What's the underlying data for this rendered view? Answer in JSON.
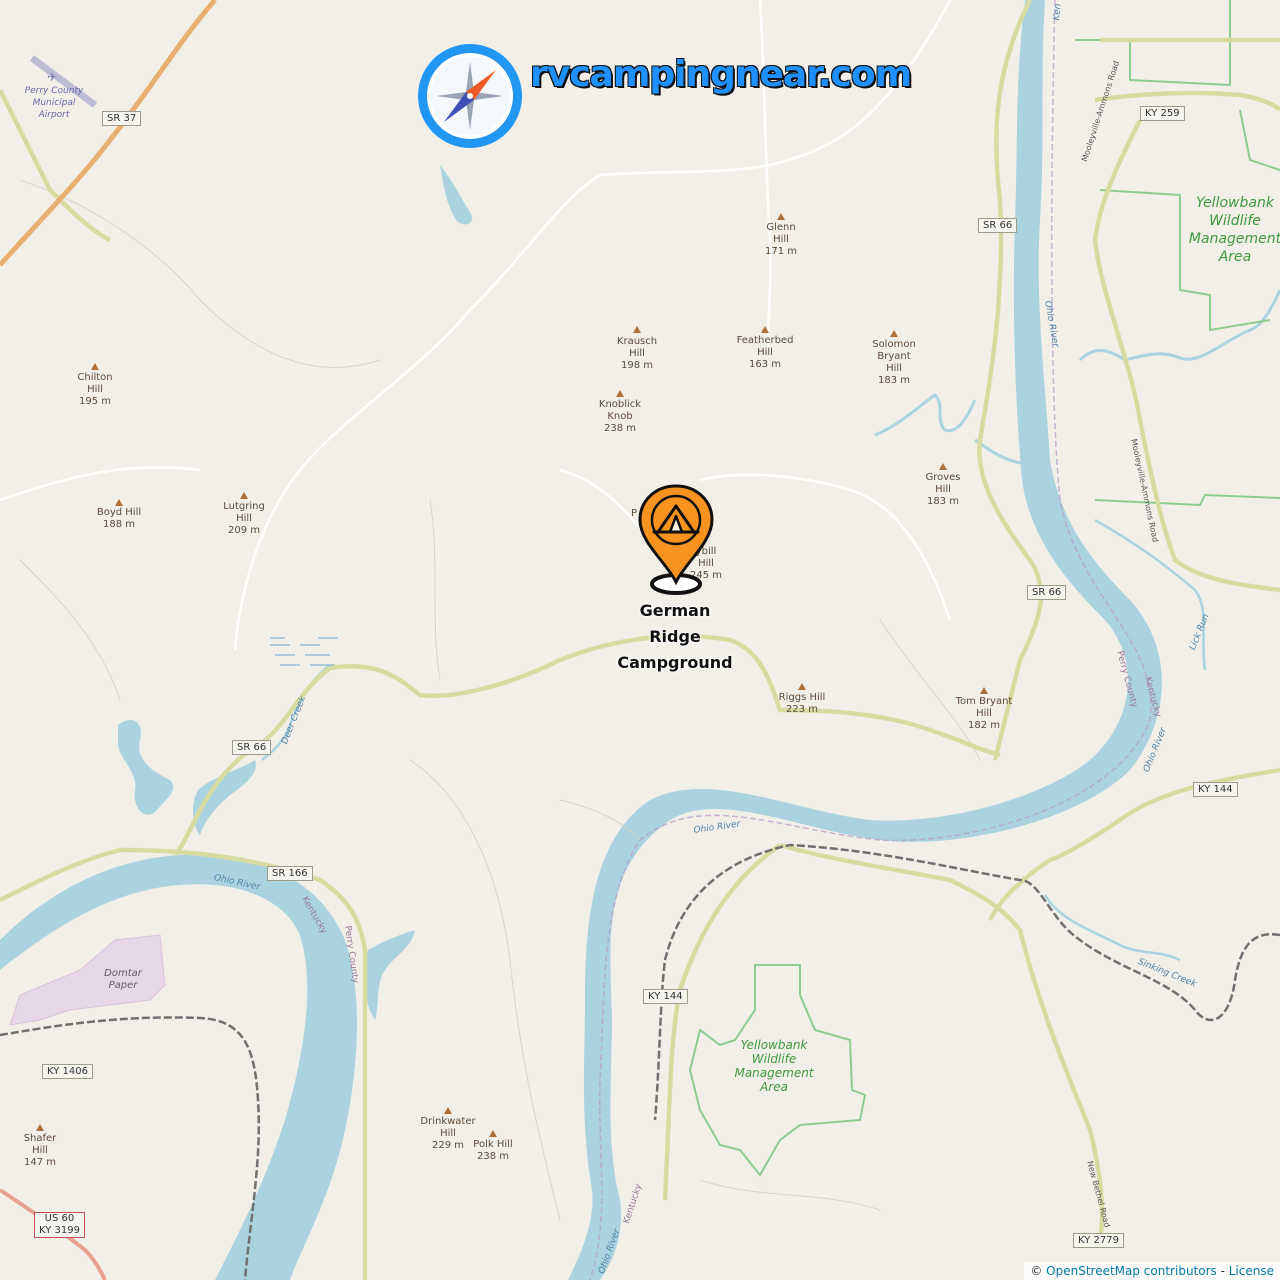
{
  "brand": {
    "text": "rvcampingnear.com",
    "icon": "compass-icon"
  },
  "campground": {
    "name": "German\nRidge\nCampground",
    "icon": "tent-pin-icon",
    "accent": "#f7931e"
  },
  "attribution": {
    "copyright": "©",
    "osm": "OpenStreetMap contributors",
    "separator": " - ",
    "license": "License"
  },
  "colors": {
    "land": "#f2efe9",
    "water": "#aad3df",
    "road_yellow": "#f7fabf",
    "road_orange": "#fcd6a4",
    "park": "#8fcb8f",
    "peak": "#b0703a"
  },
  "peaks": [
    {
      "name": "Glenn\nHill\n171 m"
    },
    {
      "name": "Krausch\nHill\n198 m"
    },
    {
      "name": "Featherbed\nHill\n163 m"
    },
    {
      "name": "Solomon\nBryant\nHill\n183 m"
    },
    {
      "name": "Chilton\nHill\n195 m"
    },
    {
      "name": "Knoblick\nKnob\n238 m"
    },
    {
      "name": "Groves\nHill\n183 m"
    },
    {
      "name": "Boyd Hill\n188 m"
    },
    {
      "name": "Lutgring\nHill\n209 m"
    },
    {
      "name": "Riggs Hill\n223 m"
    },
    {
      "name": "Tom Bryant\nHill\n182 m"
    },
    {
      "name": "Drinkwater\nHill\n229 m"
    },
    {
      "name": "Polk Hill\n238 m"
    },
    {
      "name": "Shafer\nHill\n147 m"
    }
  ],
  "partial_labels": {
    "p1": "P",
    "p2": "ybill\nHill\n245 m"
  },
  "shields": {
    "sr37": "SR 37",
    "ky259": "KY 259",
    "sr66a": "SR 66",
    "sr66b": "SR 66",
    "sr66c": "SR 66",
    "ky144a": "KY 144",
    "sr166": "SR 166",
    "ky144b": "KY 144",
    "ky1406": "KY 1406",
    "ky2779": "KY 2779",
    "us60": "US 60\nKY 3199"
  },
  "road_names": {
    "mooleyville1": "Mooleyville-Ammons Road",
    "mooleyville2": "Mooleyville-Ammons Road",
    "newbethel": "New Bethel Road"
  },
  "water": {
    "ohio1": "Ohio River",
    "ohio2": "Ohio River",
    "ohio3": "Ohio River",
    "ohio4": "Ohio River",
    "ohio5": "Ohio River",
    "deercreek": "Deer Creek",
    "lickrun": "Lick Run",
    "sinkingcreek": "Sinking Creek",
    "ken": "Ken"
  },
  "county": {
    "c1": "Perry County",
    "c2": "Kentucky",
    "c3": "Kentucky",
    "c4": "Perry County",
    "c5": "Kentucky"
  },
  "parks": {
    "p1": "Yellowbank\nWildlife\nManagement\nArea",
    "p2": "Yellowbank\nWildlife\nManagement\nArea"
  },
  "places": {
    "airport": "Perry County\nMunicipal\nAirport",
    "domtar": "Domtar\nPaper"
  }
}
